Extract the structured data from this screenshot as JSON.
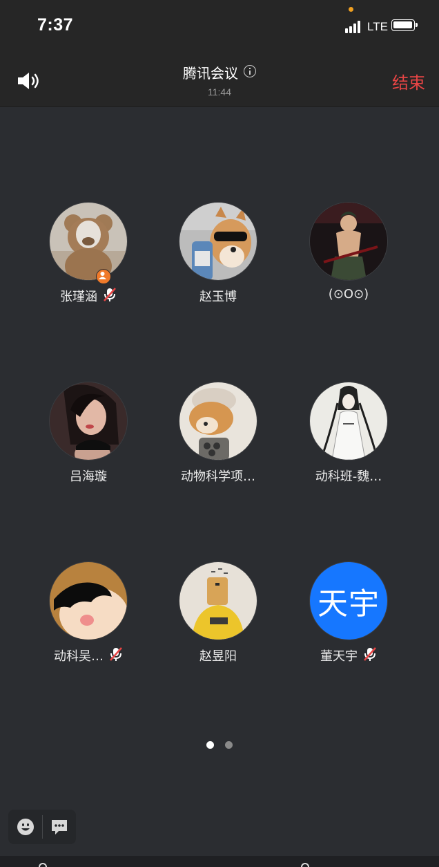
{
  "status_bar": {
    "time": "7:37",
    "network": "LTE"
  },
  "header": {
    "title": "腾讯会议",
    "elapsed": "11:44",
    "end_label": "结束"
  },
  "participants": [
    {
      "name": "张瑾涵",
      "muted": true,
      "host": true,
      "avatar": "teddy-bear"
    },
    {
      "name": "赵玉博",
      "muted": false,
      "host": false,
      "avatar": "dog-with-sunglasses"
    },
    {
      "name": "(⊙O⊙)",
      "muted": false,
      "host": false,
      "avatar": "anime-swordsman"
    },
    {
      "name": "吕海璇",
      "muted": false,
      "host": false,
      "avatar": "couple-photo"
    },
    {
      "name": "动物科学项…",
      "muted": false,
      "host": false,
      "avatar": "shiba-dog"
    },
    {
      "name": "动科班-魏…",
      "muted": false,
      "host": false,
      "avatar": "ink-painting-figure"
    },
    {
      "name": "动科吴…",
      "muted": true,
      "host": false,
      "avatar": "cartoon-face"
    },
    {
      "name": "赵昱阳",
      "muted": false,
      "host": false,
      "avatar": "bag-head-person"
    },
    {
      "name": "董天宇",
      "muted": true,
      "host": false,
      "avatar": "text-avatar",
      "avatar_text": "天宇",
      "avatar_color": "#1677ff"
    }
  ],
  "pagination": {
    "pages": 2,
    "current": 1
  },
  "colors": {
    "background": "#2b2d31",
    "header": "#262626",
    "end": "#e94545",
    "host_badge": "#f07a2a",
    "muted_mic": "#e94545"
  }
}
